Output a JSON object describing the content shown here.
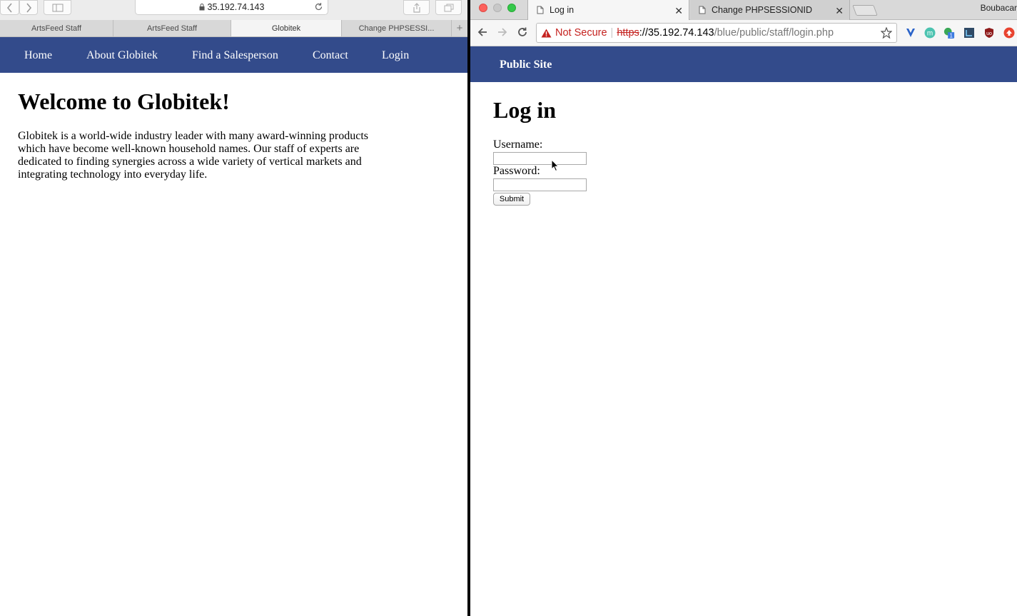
{
  "safari": {
    "address": "35.192.74.143",
    "tabs": [
      "ArtsFeed Staff",
      "ArtsFeed Staff",
      "Globitek",
      "Change PHPSESSI..."
    ],
    "active_tab_index": 2,
    "new_tab_symbol": "+"
  },
  "globitek": {
    "nav": [
      "Home",
      "About Globitek",
      "Find a Salesperson",
      "Contact",
      "Login"
    ],
    "heading": "Welcome to Globitek!",
    "paragraph": "Globitek is a world-wide industry leader with many award-winning products which have become well-known household names. Our staff of experts are dedicated to finding synergies across a wide variety of vertical markets and integrating technology into everyday life."
  },
  "chrome": {
    "tabs": [
      {
        "title": "Log in",
        "close": "✕"
      },
      {
        "title": "Change PHPSESSIONID",
        "close": "✕"
      }
    ],
    "profile_name": "Boubacar",
    "security_label": "Not Secure",
    "url_scheme": "https",
    "url_host": "://35.192.74.143",
    "url_path": "/blue/public/staff/login.php",
    "extension_icons": [
      "vimium-icon",
      "m-extension-icon",
      "green-badge-extension-icon",
      "dark-extension-icon",
      "ublock-icon",
      "red-up-arrow-extension-icon"
    ],
    "extension_badge": "1"
  },
  "staff_site": {
    "nav_link": "Public Site",
    "title": "Log in",
    "username_label": "Username:",
    "password_label": "Password:",
    "username_value": "",
    "password_value": "",
    "submit_label": "Submit"
  },
  "colors": {
    "nav_blue": "#334b8b",
    "not_secure_red": "#c5221f"
  }
}
